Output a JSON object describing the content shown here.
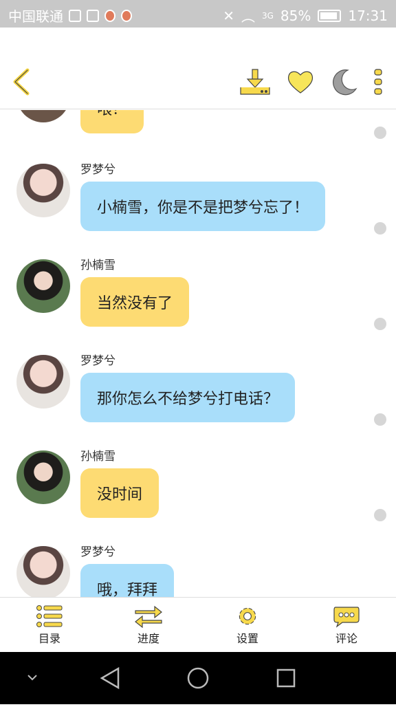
{
  "status_bar": {
    "carrier": "中国联通",
    "battery_percent": "85%",
    "time": "17:31",
    "network": "3G"
  },
  "toolbar": {
    "icons": [
      "back-icon",
      "download-icon",
      "heart-icon",
      "moon-icon",
      "more-vertical-icon"
    ]
  },
  "chat": {
    "partial_top_message": {
      "text": "喂？"
    },
    "messages": [
      {
        "name": "罗梦兮",
        "text": "小楠雪，你是不是把梦兮忘了！",
        "bubble_color": "#a9defa"
      },
      {
        "name": "孙楠雪",
        "text": "当然没有了",
        "bubble_color": "#fddb73"
      },
      {
        "name": "罗梦兮",
        "text": "那你怎么不给梦兮打电话？",
        "bubble_color": "#a9defa"
      },
      {
        "name": "孙楠雪",
        "text": "没时间",
        "bubble_color": "#fddb73"
      },
      {
        "name": "罗梦兮",
        "text": "哦，拜拜",
        "bubble_color": "#a9defa"
      }
    ]
  },
  "bottom_nav": {
    "items": [
      {
        "label": "目录",
        "icon": "list-icon"
      },
      {
        "label": "进度",
        "icon": "swap-arrows-icon"
      },
      {
        "label": "设置",
        "icon": "gear-icon"
      },
      {
        "label": "评论",
        "icon": "comment-bubble-icon"
      }
    ]
  },
  "colors": {
    "accent": "#f7d94c",
    "blue_bubble": "#a9defa",
    "yellow_bubble": "#fddb73"
  }
}
